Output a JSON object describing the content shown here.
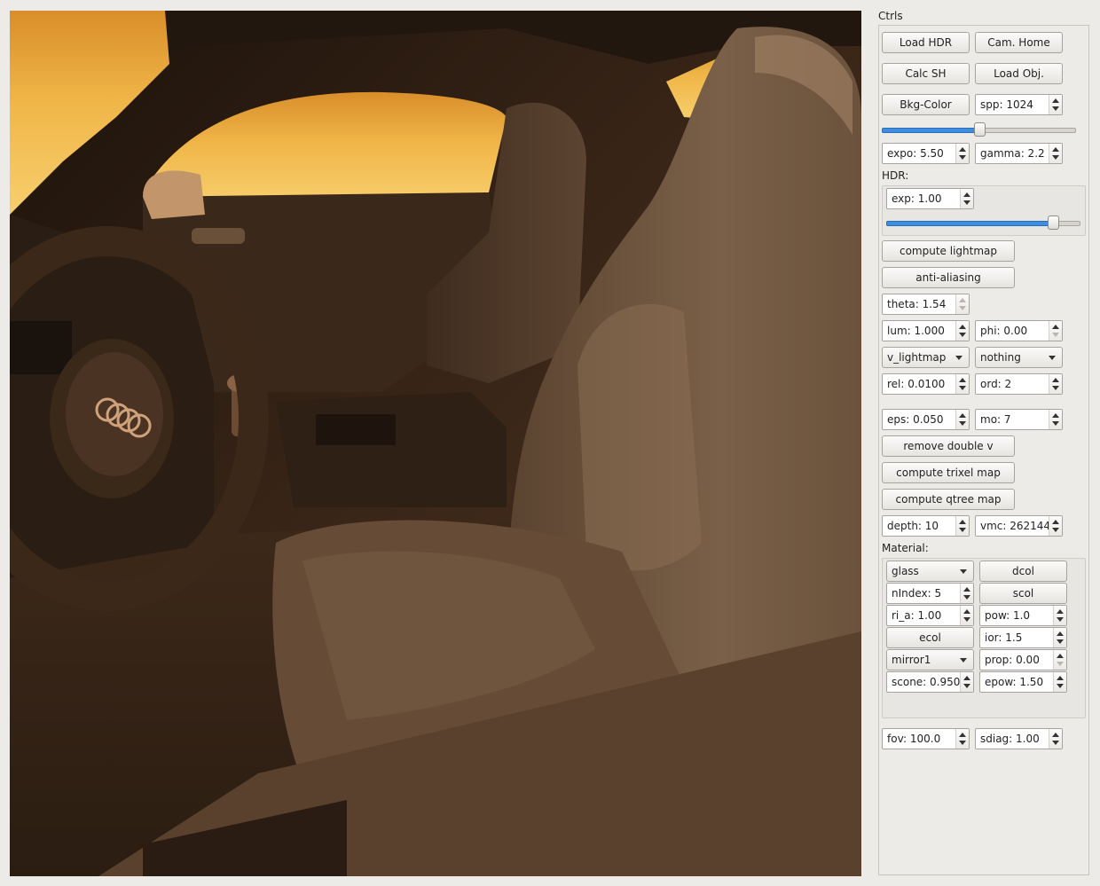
{
  "panel": {
    "title": "Ctrls",
    "buttons": {
      "load_hdr": "Load HDR",
      "cam_home": "Cam. Home",
      "calc_sh": "Calc SH",
      "load_obj": "Load Obj.",
      "bkg_color": "Bkg-Color",
      "compute_lightmap": "compute lightmap",
      "anti_aliasing": "anti-aliasing",
      "remove_double_v": "remove double v",
      "compute_trixel_map": "compute trixel map",
      "compute_qtree_map": "compute qtree map"
    },
    "spp": "spp: 1024",
    "spp_slider": {
      "value": 0.5
    },
    "expo": "expo: 5.50",
    "gamma": "gamma: 2.2",
    "hdr": {
      "label": "HDR:",
      "exp": "exp: 1.00",
      "slider": {
        "value": 0.86
      }
    },
    "theta": "theta: 1.54",
    "lum": "lum: 1.000",
    "phi": "phi: 0.00",
    "mode_select": "v_lightmap",
    "second_select": "nothing",
    "rel": "rel: 0.0100",
    "ord": "ord: 2",
    "eps": "eps: 0.050",
    "mo": "mo: 7",
    "depth": "depth: 10",
    "vmc": "vmc: 262144",
    "material": {
      "label": "Material:",
      "type_select": "glass",
      "dcol": "dcol",
      "nindex": "nIndex: 5",
      "scol": "scol",
      "ri_a": "ri_a: 1.00",
      "pow": "pow: 1.0",
      "ecol": "ecol",
      "ior": "ior: 1.5",
      "mirror_select": "mirror1",
      "prop": "prop: 0.00",
      "scone": "scone: 0.950",
      "epow": "epow: 1.50"
    },
    "fov": "fov: 100.0",
    "sdiag": "sdiag: 1.00"
  },
  "colors": {
    "slider_fill": "#3d8ee0",
    "panel_bg": "#edebe7"
  },
  "viewport": {
    "scene": "car-interior-render",
    "badge_text": ""
  }
}
